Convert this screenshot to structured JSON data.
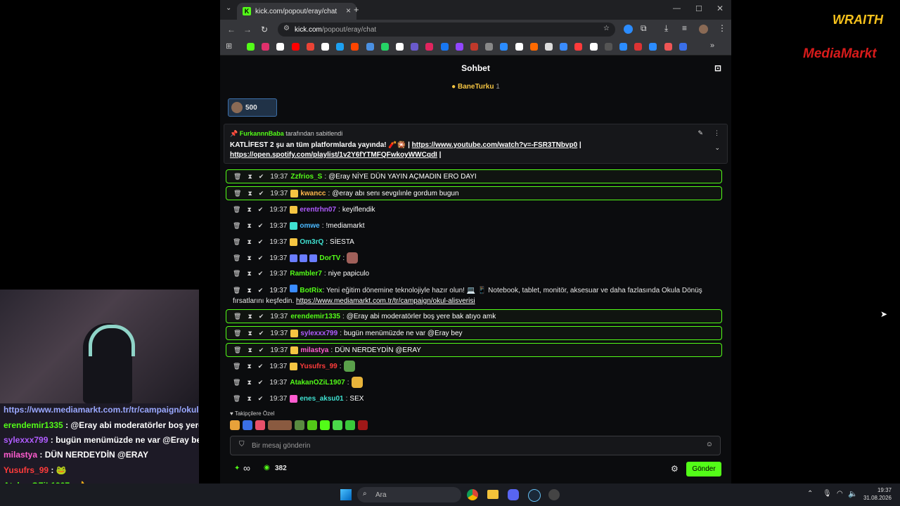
{
  "browser": {
    "tab_title": "kick.com/popout/eray/chat",
    "url_host": "kick.com",
    "url_path": "/popout/eray/chat"
  },
  "chat": {
    "header": "Sohbet",
    "top_gifter": "BaneTurku",
    "top_gifter_count": "1",
    "gift_amount": "500",
    "pinned_by_user": "FurkannnBaba",
    "pinned_by_suffix": " tarafından sabitlendi",
    "pinned_text": "KATLİFEST 2 şu an tüm platformlarda yayında! 🧨🎇 |",
    "pinned_link1": "https://www.youtube.com/watch?v=-FSR3TNbvp0",
    "pinned_link2": "https://open.spotify.com/playlist/1v2Y6fYTMFQFwkoyWWCqdI",
    "messages": [
      {
        "time": "19:37",
        "user": "Zzfrios_S",
        "color": "#53fc18",
        "text": "@Eray NİYE DÜN YAYIN AÇMADIN ERO DAYI",
        "hl": true,
        "badges": []
      },
      {
        "time": "19:37",
        "user": "kwancc",
        "color": "#ffb84d",
        "text": "@eray abı senı sevgılınle gordum bugun",
        "hl": true,
        "badges": [
          "10"
        ]
      },
      {
        "time": "19:37",
        "user": "erentrhn07",
        "color": "#b05cff",
        "text": "keyiflendik",
        "hl": false,
        "badges": [
          "11"
        ]
      },
      {
        "time": "19:37",
        "user": "omwe",
        "color": "#4ab8ff",
        "text": "!mediamarkt",
        "hl": false,
        "badges": [
          "25"
        ]
      },
      {
        "time": "19:37",
        "user": "Om3rQ",
        "color": "#3fe0d0",
        "text": "SİESTA",
        "hl": false,
        "badges": [
          "10"
        ]
      },
      {
        "time": "19:37",
        "user": "DorTV",
        "color": "#53fc18",
        "text": "",
        "hl": false,
        "badges": [
          "b",
          "b",
          "b"
        ]
      },
      {
        "time": "19:37",
        "user": "Rambler7",
        "color": "#53fc18",
        "text": "niye papiculo",
        "hl": false,
        "badges": []
      },
      {
        "time": "19:37",
        "user": "erendemir1335",
        "color": "#53fc18",
        "text": "@Eray abi moderatörler boş yere bak atıyo amk",
        "hl": true,
        "badges": []
      },
      {
        "time": "19:37",
        "user": "sylexxx799",
        "color": "#b05cff",
        "text": "bugün menümüzde ne var @Eray bey",
        "hl": true,
        "badges": [
          "18"
        ]
      },
      {
        "time": "19:37",
        "user": "milastya",
        "color": "#ff5ccf",
        "text": "DÜN NERDEYDİN @ERAY",
        "hl": true,
        "badges": [
          "16"
        ]
      },
      {
        "time": "19:37",
        "user": "Yusufrs_99",
        "color": "#ff3b3b",
        "text": "",
        "hl": false,
        "badges": [
          "19"
        ]
      },
      {
        "time": "19:37",
        "user": "AtakanOZiL1907",
        "color": "#53fc18",
        "text": "",
        "hl": false,
        "badges": []
      },
      {
        "time": "19:37",
        "user": "enes_aksu01",
        "color": "#3fe0d0",
        "text": "SEX",
        "hl": false,
        "badges": [
          "p"
        ]
      }
    ],
    "botrix_user": "BotRix",
    "botrix_text": "Yeni eğitim dönemine teknolojiyle hazır olun! 💻 📱 Notebook, tablet, monitör, aksesuar ve daha fazlasında Okula Dönüş fırsatlarını keşfedin.",
    "botrix_link": "https://www.mediamarkt.com.tr/tr/campaign/okul-alisverisi",
    "followers_label": "Takipçilere Özel",
    "input_placeholder": "Bir mesaj gönderin",
    "infinity": "∞",
    "points": "382",
    "send_label": "Gönder"
  },
  "overlay": {
    "lines": [
      {
        "user": "",
        "text": "https://www.mediamarkt.com.tr/tr/campaign/okul-a",
        "ucolor": "#9aa8ff"
      },
      {
        "user": "erendemir1335",
        "text": " : @Eray abi moderatörler boş yere b",
        "ucolor": "#53fc18"
      },
      {
        "user": "sylexxx799",
        "text": " : bugün menümüzde ne var @Eray bey",
        "ucolor": "#b05cff"
      },
      {
        "user": "milastya",
        "text": " : DÜN NERDEYDİN @ERAY",
        "ucolor": "#ff5ccf"
      },
      {
        "user": "Yusufrs_99",
        "text": " : 🐸",
        "ucolor": "#ff3b3b"
      },
      {
        "user": "AtakanOZiL1907",
        "text": " : 👌",
        "ucolor": "#53fc18"
      },
      {
        "user": "enes_aksu01",
        "text": " : SEX",
        "ucolor": "#3fe0d0"
      }
    ],
    "brand1": "WRAITH",
    "brand2": "MediaMarkt"
  },
  "taskbar": {
    "search": "Ara",
    "time": "19:37",
    "date": "31.08.2026"
  }
}
